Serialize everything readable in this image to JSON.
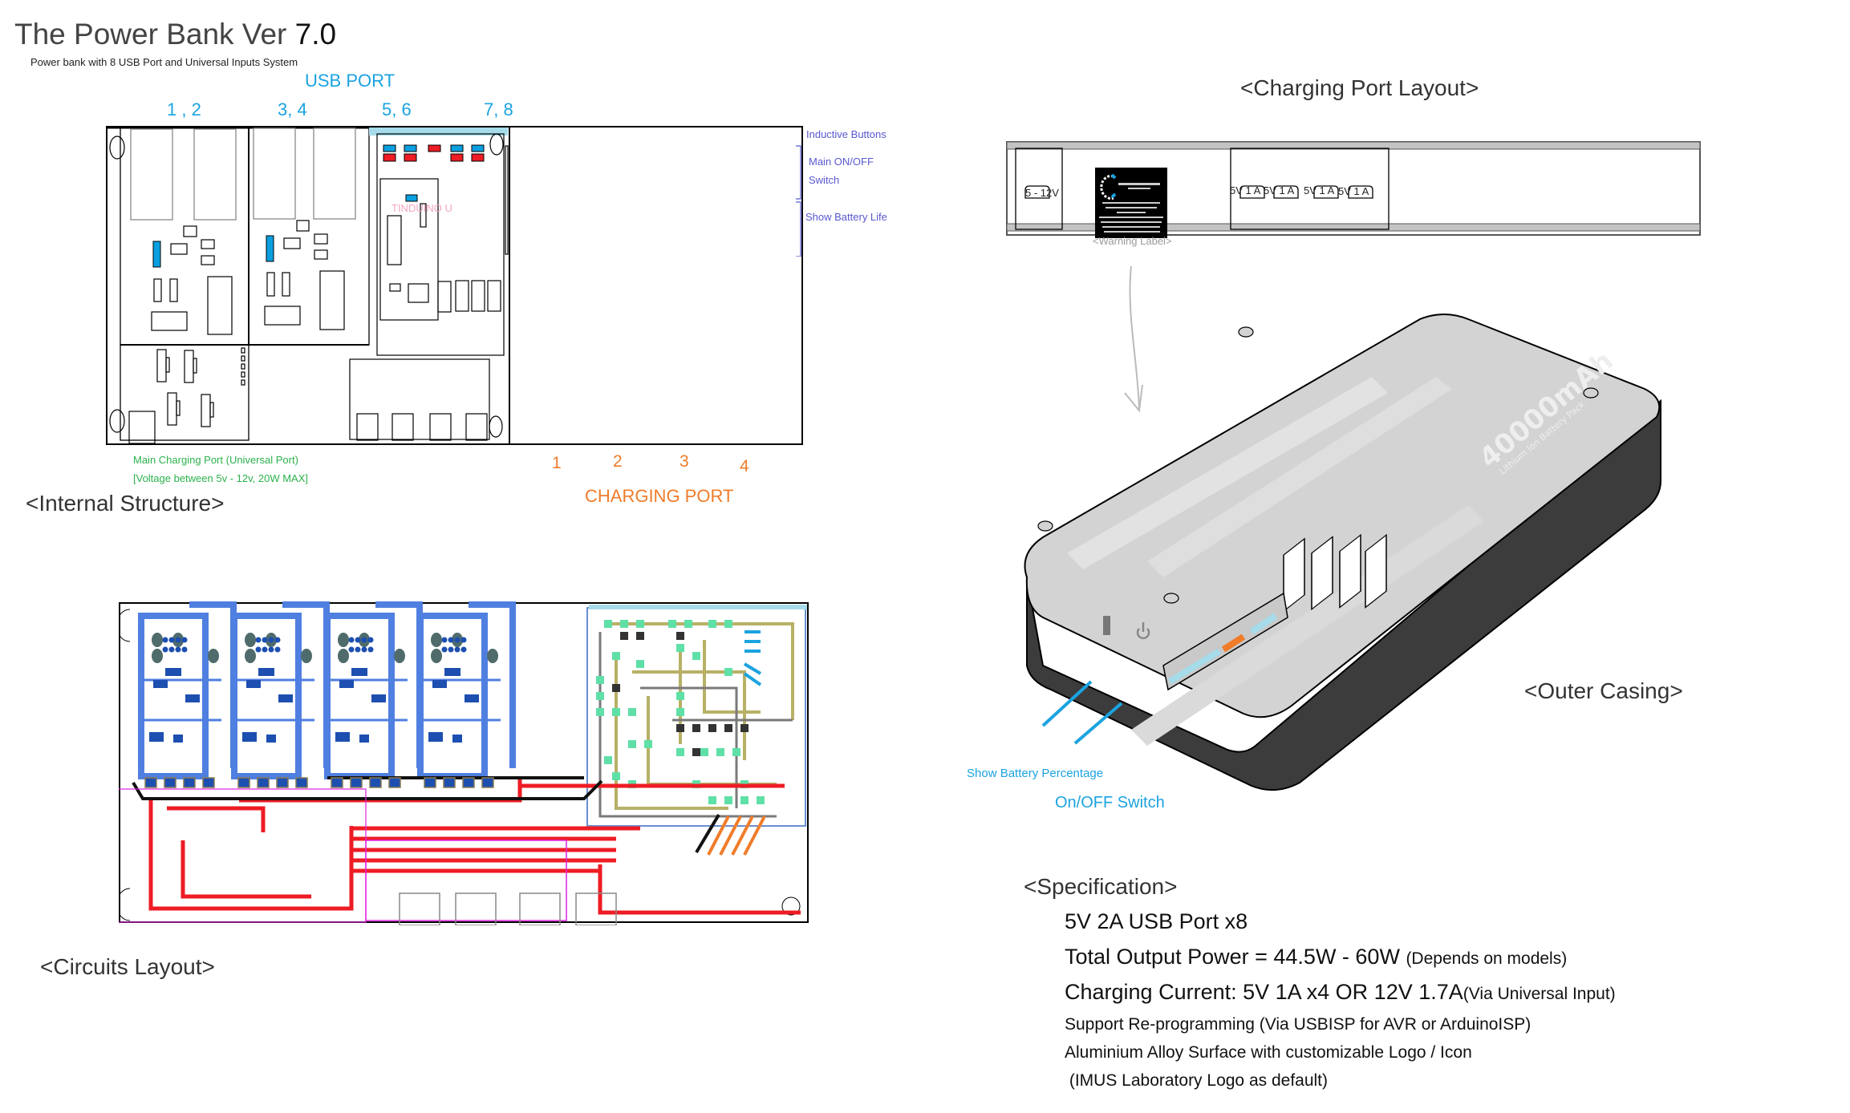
{
  "header": {
    "title_main": "The Power Bank Ver ",
    "title_version": "7.0",
    "subtitle": "Power bank with 8 USB Port and Universal Inputs System"
  },
  "internal_structure": {
    "section_label": "<Internal Structure>",
    "usb_port_title": "USB PORT",
    "usb_port_groups": [
      "1 , 2",
      "3, 4",
      "5, 6",
      "7, 8"
    ],
    "side_notes": {
      "inductive_buttons": "Inductive Buttons",
      "main_switch_line1": "Main ON/OFF",
      "main_switch_line2": "Switch",
      "battery_life": "Show Battery Life"
    },
    "board_label": "TINDUINO U",
    "main_charging_line1": "Main Charging Port (Universal Port)",
    "main_charging_line2": "[Voltage between 5v - 12v, 20W MAX]",
    "charging_port_title": "CHARGING PORT",
    "charging_port_numbers": [
      "1",
      "2",
      "3",
      "4"
    ]
  },
  "circuits": {
    "section_label": "<Circuits Layout>"
  },
  "charging_port_layout": {
    "section_label": "<Charging Port Layout>",
    "input_port_label": "5 - 12V",
    "output_port_labels": [
      "5V 1 A",
      "5V 1 A",
      "5V 1 A",
      "5V 1 A"
    ],
    "warning_label_caption": "<Warning Label>",
    "warning_label_brand": "IMUS LABORATORY"
  },
  "outer_casing": {
    "section_label": "<Outer Casing>",
    "capacity": "40000mAh",
    "capacity_sub": "Lithium Ion Battery Pack",
    "callout_battery": "Show Battery Percentage",
    "callout_switch": "On/OFF Switch"
  },
  "specification": {
    "section_label": "<Specification>",
    "items": [
      {
        "main": "5V 2A USB Port x8",
        "note": ""
      },
      {
        "main": "Total Output Power = 44.5W - 60W ",
        "note": "(Depends on models)"
      },
      {
        "main": "Charging Current: 5V 1A x4 OR 12V 1.7A",
        "note": "(Via Universal Input)"
      }
    ],
    "small_items": [
      "Support Re-programming (Via USBISP for AVR or ArduinoISP)",
      "Aluminium Alloy Surface with customizable Logo / Icon",
      " (IMUS Laboratory Logo as default)"
    ]
  },
  "colors": {
    "accent_blue": "#1ba3e0",
    "note_purple": "#5858d0",
    "charge_green": "#2bb24c",
    "charge_orange": "#f07c2a",
    "trace_red": "#ee1c24",
    "trace_blue": "#4f7fe0"
  }
}
